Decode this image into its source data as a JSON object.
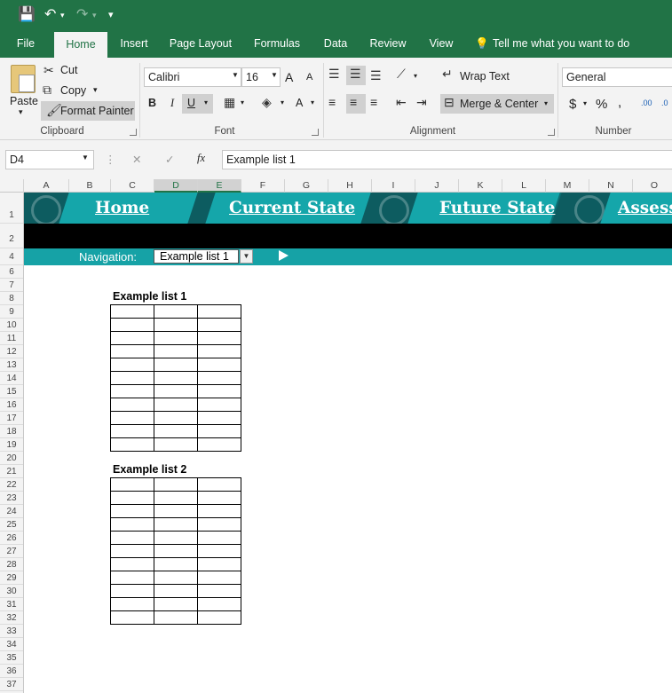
{
  "qat": {
    "save": "💾",
    "undo": "↶",
    "redo": "↷",
    "customize": "▾"
  },
  "tabs": [
    "File",
    "Home",
    "Insert",
    "Page Layout",
    "Formulas",
    "Data",
    "Review",
    "View"
  ],
  "tell_me": "Tell me what you want to do",
  "ribbon": {
    "clipboard": {
      "paste": "Paste",
      "cut": "Cut",
      "copy": "Copy",
      "format_painter": "Format Painter",
      "label": "Clipboard"
    },
    "font": {
      "name": "Calibri",
      "size": "16",
      "bold": "B",
      "italic": "I",
      "underline": "U",
      "grow": "A",
      "shrink": "A",
      "font_color": "A",
      "label": "Font"
    },
    "alignment": {
      "wrap": "Wrap Text",
      "merge": "Merge & Center",
      "label": "Alignment"
    },
    "number": {
      "format": "General",
      "currency": "$",
      "percent": "%",
      "comma": ",",
      "inc_dec": ".00",
      "label": "Number"
    }
  },
  "formula_bar": {
    "name_box": "D4",
    "cancel": "✕",
    "enter": "✓",
    "fx": "fx",
    "value": "Example list 1"
  },
  "columns": [
    "A",
    "B",
    "C",
    "D",
    "E",
    "F",
    "G",
    "H",
    "I",
    "J",
    "K",
    "L",
    "M",
    "N",
    "O"
  ],
  "rows": [
    "1",
    "2",
    "4",
    "6",
    "7",
    "8",
    "9",
    "10",
    "11",
    "12",
    "13",
    "14",
    "15",
    "16",
    "17",
    "18",
    "19",
    "20",
    "21",
    "22",
    "23",
    "24",
    "25",
    "26",
    "27",
    "28",
    "29",
    "30",
    "31",
    "32",
    "33",
    "34",
    "35",
    "36",
    "37"
  ],
  "banner": {
    "links": [
      "Home",
      "Current State",
      "Future State",
      "Assess"
    ]
  },
  "navigation": {
    "label": "Navigation:",
    "selected": "Example list 1"
  },
  "lists": [
    {
      "title": "Example list 1",
      "rows": 11,
      "cols": 3
    },
    {
      "title": "Example list 2",
      "rows": 11,
      "cols": 3
    }
  ],
  "colors": {
    "excel_green": "#217346",
    "teal": "#16a2a6",
    "dark_teal": "#0c6f73"
  }
}
